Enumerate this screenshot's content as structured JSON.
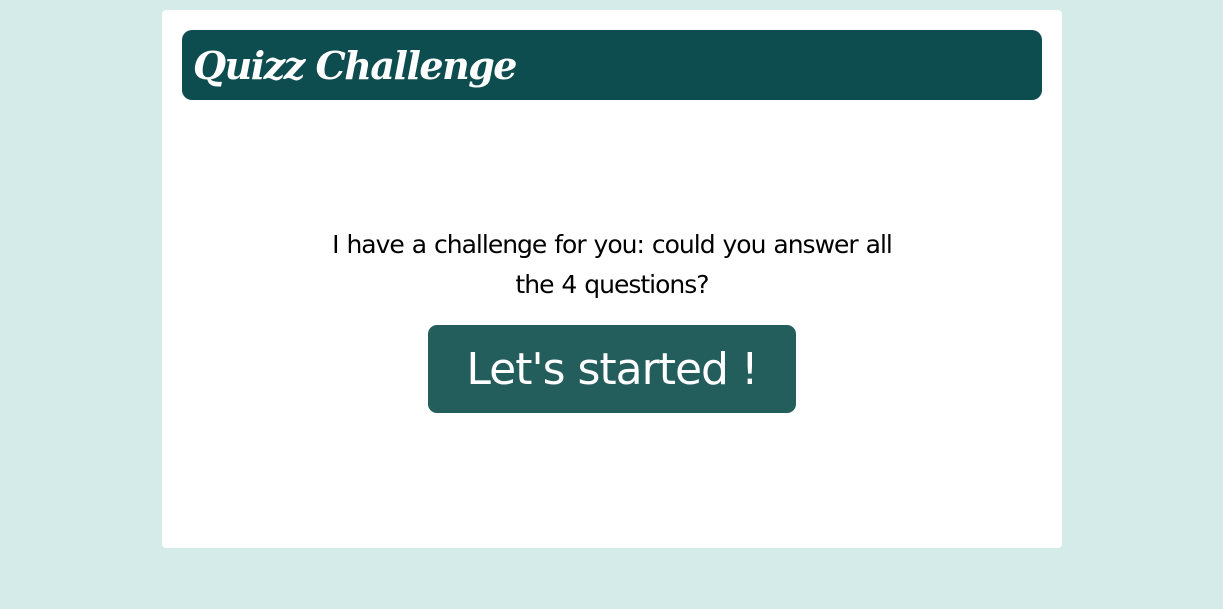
{
  "header": {
    "title": "Quizz Challenge"
  },
  "intro": {
    "text": "I have a challenge for you: could you answer all the 4 questions?"
  },
  "actions": {
    "start_label": "Let's started !"
  },
  "colors": {
    "page_background": "#d4ebea",
    "header_background": "#0e4d4f",
    "button_background": "#245e5c",
    "card_background": "#ffffff"
  }
}
